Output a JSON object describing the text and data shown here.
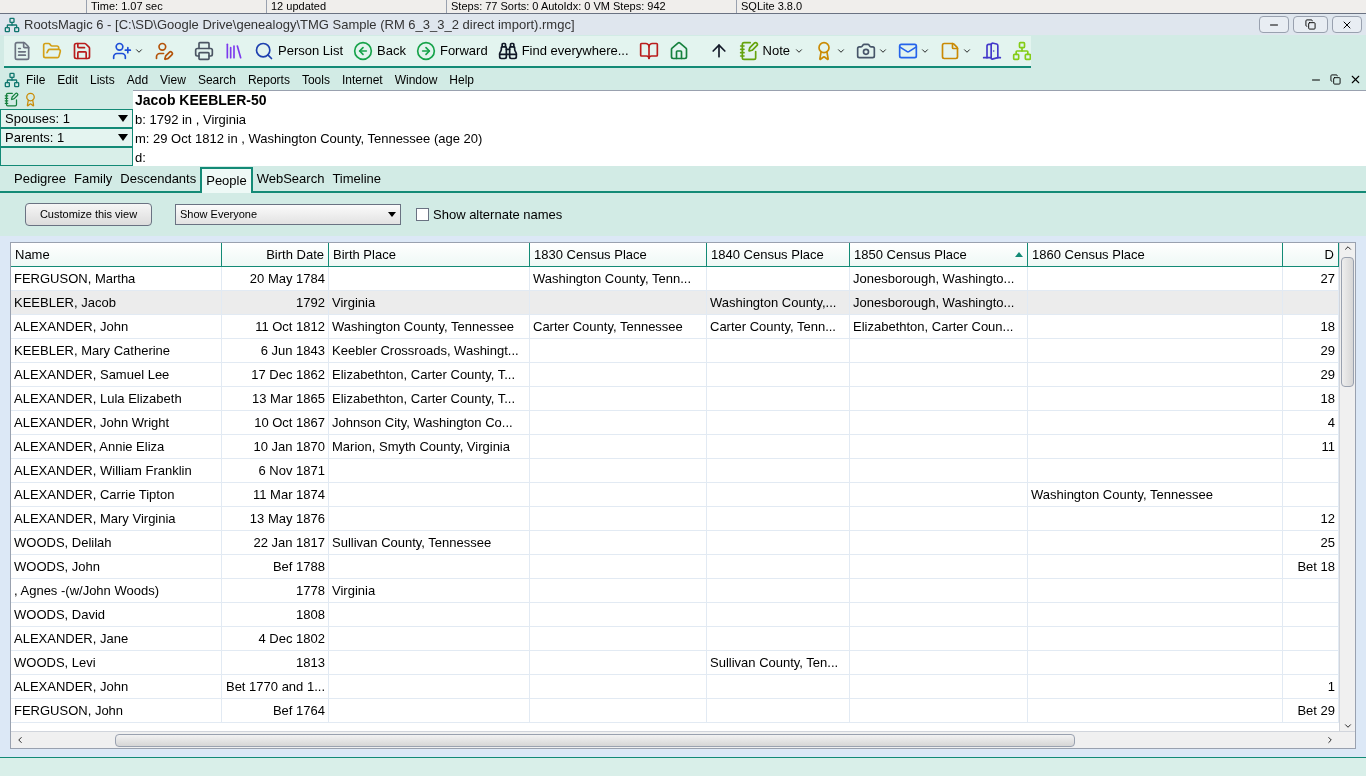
{
  "other_window_status": [
    "Time: 1.07 sec",
    "12 updated",
    "Steps: 77  Sorts: 0  AutoIdx: 0  VM Steps: 942",
    "SQLite 3.8.0"
  ],
  "window": {
    "title": "RootsMagic 6 - [C:\\SD\\Google Drive\\genealogy\\TMG Sample (RM 6_3_3_2 direct import).rmgc]"
  },
  "toolbar": [
    {
      "kind": "icon",
      "dropdown": false
    },
    {
      "kind": "icon",
      "dropdown": false
    },
    {
      "kind": "icon",
      "dropdown": false
    },
    {
      "kind": "sep"
    },
    {
      "kind": "icon",
      "dropdown": true
    },
    {
      "kind": "icon",
      "dropdown": false
    },
    {
      "kind": "sep"
    },
    {
      "kind": "icon",
      "dropdown": false
    },
    {
      "kind": "icon",
      "dropdown": false
    },
    {
      "kind": "labeled",
      "label": "Person List",
      "dropdown": false
    },
    {
      "kind": "labeled",
      "label": "Back",
      "dropdown": false
    },
    {
      "kind": "labeled",
      "label": "Forward",
      "dropdown": false
    },
    {
      "kind": "labeled",
      "label": "Find everywhere...",
      "dropdown": false
    },
    {
      "kind": "icon",
      "dropdown": false
    },
    {
      "kind": "icon",
      "dropdown": false
    },
    {
      "kind": "sep"
    },
    {
      "kind": "icon",
      "dropdown": false
    },
    {
      "kind": "labeled",
      "label": "Note",
      "dropdown": true
    },
    {
      "kind": "icon",
      "dropdown": true
    },
    {
      "kind": "icon",
      "dropdown": true
    },
    {
      "kind": "icon",
      "dropdown": true
    },
    {
      "kind": "icon",
      "dropdown": true
    },
    {
      "kind": "icon",
      "dropdown": false
    },
    {
      "kind": "icon",
      "dropdown": false
    }
  ],
  "menu": [
    "File",
    "Edit",
    "Lists",
    "Add",
    "View",
    "Search",
    "Reports",
    "Tools",
    "Internet",
    "Window",
    "Help"
  ],
  "side_panel": {
    "dropdowns": [
      "Spouses: 1",
      "Parents: 1"
    ]
  },
  "person": {
    "name": "Jacob KEEBLER-50",
    "lines": [
      "b: 1792 in , Virginia",
      "m: 29 Oct 1812 in , Washington County, Tennessee (age 20)",
      "d:"
    ]
  },
  "tabs": [
    {
      "label": "Pedigree",
      "selected": false
    },
    {
      "label": "Family",
      "selected": false
    },
    {
      "label": "Descendants",
      "selected": false
    },
    {
      "label": "People",
      "selected": true
    },
    {
      "label": "WebSearch",
      "selected": false
    },
    {
      "label": "Timeline",
      "selected": false
    }
  ],
  "view_controls": {
    "customize_button": "Customize this view",
    "filter": "Show Everyone",
    "alternate_names": {
      "label": "Show alternate names",
      "checked": false
    }
  },
  "table": {
    "columns": [
      {
        "label": "Name",
        "sorted": false
      },
      {
        "label": "Birth Date",
        "sorted": false
      },
      {
        "label": "Birth Place",
        "sorted": false
      },
      {
        "label": "1830 Census Place",
        "sorted": false
      },
      {
        "label": "1840 Census Place",
        "sorted": false
      },
      {
        "label": "1850 Census Place",
        "sorted": true
      },
      {
        "label": "1860 Census Place",
        "sorted": false
      },
      {
        "label": "D",
        "sorted": false
      }
    ],
    "rows": [
      {
        "selected": false,
        "name": "FERGUSON, Martha",
        "birth_date": "20 May 1784",
        "census_1830": "Washington County, Tenn...",
        "census_1850": "Jonesborough, Washingto...",
        "column_9": "27"
      },
      {
        "selected": true,
        "name": "KEEBLER, Jacob",
        "birth_date": "1792",
        "birth_place": "Virginia",
        "census_1840": "Washington County,...",
        "census_1850": "Jonesborough, Washingto..."
      },
      {
        "selected": false,
        "name": "ALEXANDER, John",
        "birth_date": "11 Oct 1812",
        "birth_place": "Washington County, Tennessee",
        "census_1830": "Carter County, Tennessee",
        "census_1840": "Carter County, Tenn...",
        "census_1850": "Elizabethton, Carter Coun...",
        "column_9": "18"
      },
      {
        "selected": false,
        "name": "KEEBLER, Mary Catherine",
        "birth_date": "6 Jun 1843",
        "birth_place": "Keebler Crossroads, Washingt...",
        "column_9": "29"
      },
      {
        "selected": false,
        "name": "ALEXANDER, Samuel Lee",
        "birth_date": "17 Dec 1862",
        "birth_place": "Elizabethton, Carter County, T...",
        "column_9": "29"
      },
      {
        "selected": false,
        "name": "ALEXANDER, Lula Elizabeth",
        "birth_date": "13 Mar 1865",
        "birth_place": "Elizabethton, Carter County, T...",
        "column_9": "18"
      },
      {
        "selected": false,
        "name": "ALEXANDER, John Wright",
        "birth_date": "10 Oct 1867",
        "birth_place": "Johnson City, Washington Co...",
        "column_9": "4"
      },
      {
        "selected": false,
        "name": "ALEXANDER, Annie Eliza",
        "birth_date": "10 Jan 1870",
        "birth_place": "Marion, Smyth County, Virginia",
        "column_9": "11"
      },
      {
        "selected": false,
        "name": "ALEXANDER, William Franklin",
        "birth_date": "6 Nov 1871"
      },
      {
        "selected": false,
        "name": "ALEXANDER, Carrie Tipton",
        "birth_date": "11 Mar 1874",
        "census_1860": "Washington County, Tennessee"
      },
      {
        "selected": false,
        "name": "ALEXANDER, Mary Virginia",
        "birth_date": "13 May 1876",
        "column_9": "12"
      },
      {
        "selected": false,
        "name": "WOODS, Delilah",
        "birth_date": "22 Jan 1817",
        "birth_place": "Sullivan County, Tennessee",
        "column_9": "25"
      },
      {
        "selected": false,
        "name": "WOODS, John",
        "birth_date": "Bef 1788",
        "column_9": "Bet 18"
      },
      {
        "selected": false,
        "name": ", Agnes -(w/John Woods)",
        "birth_date": "1778",
        "birth_place": "Virginia"
      },
      {
        "selected": false,
        "name": "WOODS, David",
        "birth_date": "1808"
      },
      {
        "selected": false,
        "name": "ALEXANDER, Jane",
        "birth_date": "4 Dec 1802"
      },
      {
        "selected": false,
        "name": "WOODS, Levi",
        "birth_date": "1813",
        "census_1840": "Sullivan County, Ten..."
      },
      {
        "selected": false,
        "name": "ALEXANDER, John",
        "birth_date": "Bet 1770 and 1...",
        "column_9": "1"
      },
      {
        "selected": false,
        "name": "FERGUSON, John",
        "birth_date": "Bef 1764",
        "column_9": "Bet 29"
      }
    ]
  }
}
